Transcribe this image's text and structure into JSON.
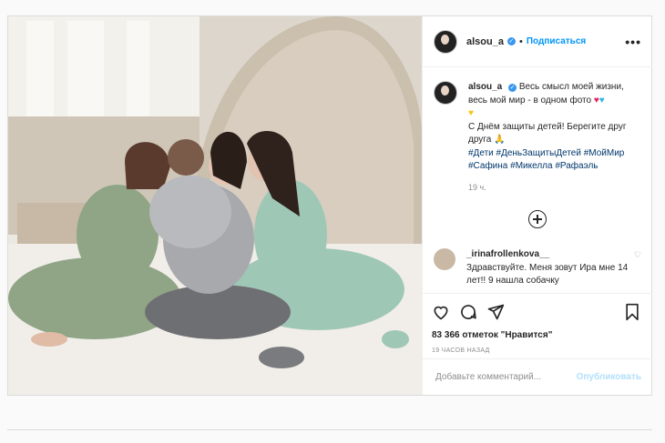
{
  "post": {
    "username": "alsou_a",
    "dot": "•",
    "follow_label": "Подписаться",
    "more": "•••",
    "caption_line1": "Весь смысл моей жизни, весь мой мир - в одном фото",
    "caption_line2": "С Днём защиты детей! Берегите друг друга",
    "hashtags": "#Дети #ДеньЗащитыДетей #МойМир #Сафина #Микелла #Рафаэль",
    "time_ago": "19 ч.",
    "comment_username": "_irinafrollenkova__",
    "comment_text": "Здравствуйте. Меня зовут Ира мне 14 лет!! 9 нашла собачку",
    "likes": "83 366 отметок \"Нравится\"",
    "posted_ago": "19 ЧАСОВ НАЗАД",
    "comment_placeholder": "Добавьте комментарий...",
    "publish_label": "Опубликовать"
  },
  "colors": {
    "accent": "#0095f6",
    "verified": "#3897f0"
  },
  "icons": [
    "heart-icon",
    "comment-icon",
    "share-icon",
    "bookmark-icon",
    "plus-circle-icon",
    "more-icon",
    "verified-icon"
  ]
}
